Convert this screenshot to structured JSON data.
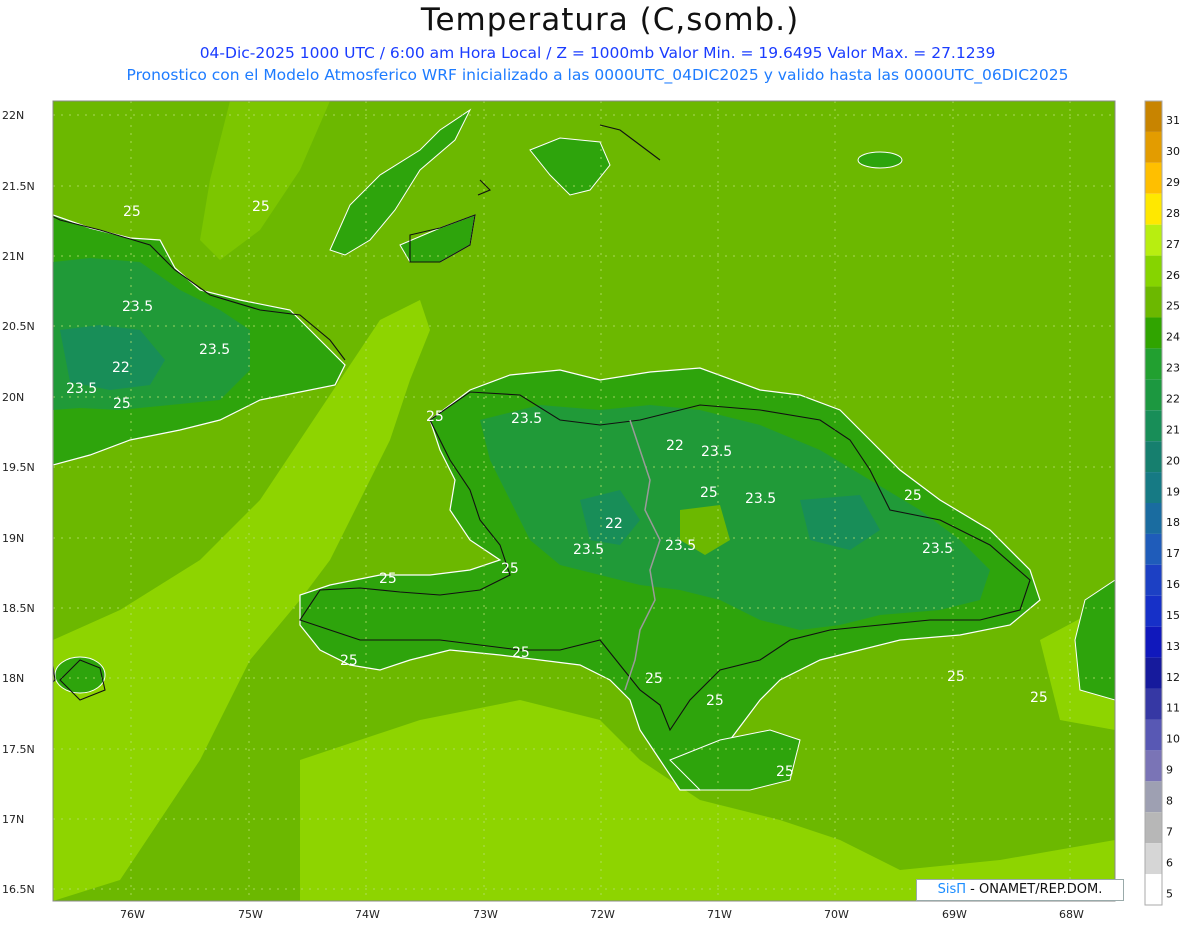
{
  "header": {
    "title": "Temperatura (C,somb.)",
    "line1": "04-Dic-2025  1000 UTC / 6:00 am Hora Local / Z = 1000mb   Valor Min. = 19.6495  Valor Max. = 27.1239",
    "line2": "Pronostico con el Modelo Atmosferico WRF inicializado a las 0000UTC_04DIC2025 y valido hasta las  0000UTC_06DIC2025"
  },
  "axes": {
    "lat_labels": [
      "22N",
      "21.5N",
      "21N",
      "20.5N",
      "20N",
      "19.5N",
      "19N",
      "18.5N",
      "18N",
      "17.5N",
      "17N",
      "16.5N"
    ],
    "lon_labels": [
      "76W",
      "75W",
      "74W",
      "73W",
      "72W",
      "71W",
      "70W",
      "69W",
      "68W"
    ]
  },
  "contour_labels": [
    "25",
    "23.5",
    "22",
    "25",
    "23.5",
    "25",
    "23.5",
    "22",
    "23.5",
    "25",
    "23.5",
    "25",
    "23.5",
    "22",
    "23.5",
    "25",
    "25",
    "23.5",
    "23.5",
    "25",
    "25",
    "25",
    "25",
    "25",
    "25",
    "25",
    "25"
  ],
  "colorbar": {
    "levels": [
      "31",
      "30",
      "29",
      "28",
      "27",
      "26",
      "25",
      "24",
      "23",
      "22",
      "21",
      "20",
      "19",
      "18",
      "17",
      "16",
      "15",
      "13",
      "12",
      "11",
      "10",
      "9",
      "8",
      "7",
      "6",
      "5"
    ],
    "colors": [
      "#c88400",
      "#e39c00",
      "#ffbf00",
      "#ffe800",
      "#b8ee10",
      "#86d400",
      "#6cb800",
      "#30a400",
      "#22a030",
      "#1c9840",
      "#188e58",
      "#167f6e",
      "#167a84",
      "#1a6ca0",
      "#1f5cba",
      "#1c40c4",
      "#1630c8",
      "#1018bc",
      "#161a9c",
      "#3638a4",
      "#5858b4",
      "#7a74b6",
      "#9ea0b2",
      "#b7b7b7",
      "#d6d6d6",
      "#ffffff"
    ]
  },
  "colors": {
    "sea_warm": "#8ed400",
    "sea_base": "#6cb800",
    "land": "#2ea40c",
    "land_cool": "#209a38"
  },
  "credit": {
    "brand": "SisΠ",
    "text": "- ONAMET/REP.DOM."
  }
}
